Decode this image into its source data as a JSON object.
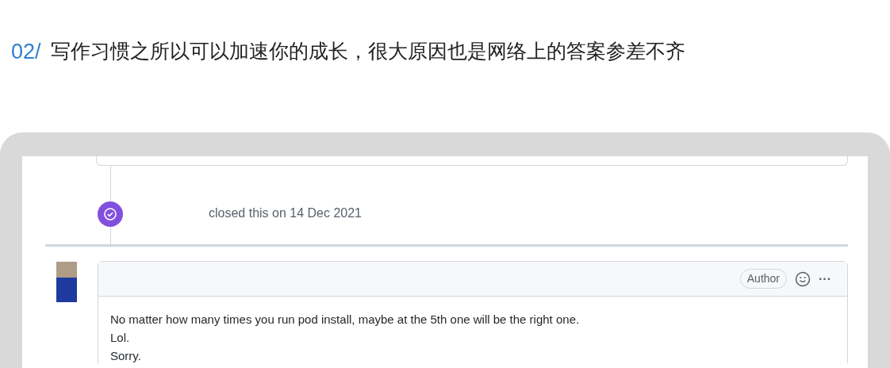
{
  "heading": {
    "number": "02/",
    "text": "写作习惯之所以可以加速你的成长，很大原因也是网络上的答案参差不齐"
  },
  "event": {
    "text": "closed this on 14 Dec 2021"
  },
  "comment": {
    "badge": "Author",
    "menu": "···",
    "lines": [
      "No matter how many times you run pod install, maybe at the 5th one will be the right one.",
      "Lol.",
      "Sorry."
    ]
  }
}
